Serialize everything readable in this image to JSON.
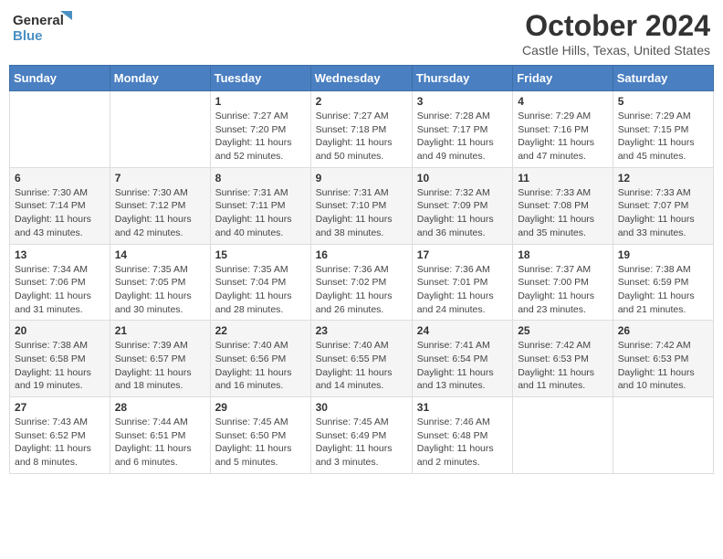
{
  "header": {
    "logo_line1": "General",
    "logo_line2": "Blue",
    "month_title": "October 2024",
    "location": "Castle Hills, Texas, United States"
  },
  "days_of_week": [
    "Sunday",
    "Monday",
    "Tuesday",
    "Wednesday",
    "Thursday",
    "Friday",
    "Saturday"
  ],
  "weeks": [
    [
      {
        "day": "",
        "info": ""
      },
      {
        "day": "",
        "info": ""
      },
      {
        "day": "1",
        "info": "Sunrise: 7:27 AM\nSunset: 7:20 PM\nDaylight: 11 hours and 52 minutes."
      },
      {
        "day": "2",
        "info": "Sunrise: 7:27 AM\nSunset: 7:18 PM\nDaylight: 11 hours and 50 minutes."
      },
      {
        "day": "3",
        "info": "Sunrise: 7:28 AM\nSunset: 7:17 PM\nDaylight: 11 hours and 49 minutes."
      },
      {
        "day": "4",
        "info": "Sunrise: 7:29 AM\nSunset: 7:16 PM\nDaylight: 11 hours and 47 minutes."
      },
      {
        "day": "5",
        "info": "Sunrise: 7:29 AM\nSunset: 7:15 PM\nDaylight: 11 hours and 45 minutes."
      }
    ],
    [
      {
        "day": "6",
        "info": "Sunrise: 7:30 AM\nSunset: 7:14 PM\nDaylight: 11 hours and 43 minutes."
      },
      {
        "day": "7",
        "info": "Sunrise: 7:30 AM\nSunset: 7:12 PM\nDaylight: 11 hours and 42 minutes."
      },
      {
        "day": "8",
        "info": "Sunrise: 7:31 AM\nSunset: 7:11 PM\nDaylight: 11 hours and 40 minutes."
      },
      {
        "day": "9",
        "info": "Sunrise: 7:31 AM\nSunset: 7:10 PM\nDaylight: 11 hours and 38 minutes."
      },
      {
        "day": "10",
        "info": "Sunrise: 7:32 AM\nSunset: 7:09 PM\nDaylight: 11 hours and 36 minutes."
      },
      {
        "day": "11",
        "info": "Sunrise: 7:33 AM\nSunset: 7:08 PM\nDaylight: 11 hours and 35 minutes."
      },
      {
        "day": "12",
        "info": "Sunrise: 7:33 AM\nSunset: 7:07 PM\nDaylight: 11 hours and 33 minutes."
      }
    ],
    [
      {
        "day": "13",
        "info": "Sunrise: 7:34 AM\nSunset: 7:06 PM\nDaylight: 11 hours and 31 minutes."
      },
      {
        "day": "14",
        "info": "Sunrise: 7:35 AM\nSunset: 7:05 PM\nDaylight: 11 hours and 30 minutes."
      },
      {
        "day": "15",
        "info": "Sunrise: 7:35 AM\nSunset: 7:04 PM\nDaylight: 11 hours and 28 minutes."
      },
      {
        "day": "16",
        "info": "Sunrise: 7:36 AM\nSunset: 7:02 PM\nDaylight: 11 hours and 26 minutes."
      },
      {
        "day": "17",
        "info": "Sunrise: 7:36 AM\nSunset: 7:01 PM\nDaylight: 11 hours and 24 minutes."
      },
      {
        "day": "18",
        "info": "Sunrise: 7:37 AM\nSunset: 7:00 PM\nDaylight: 11 hours and 23 minutes."
      },
      {
        "day": "19",
        "info": "Sunrise: 7:38 AM\nSunset: 6:59 PM\nDaylight: 11 hours and 21 minutes."
      }
    ],
    [
      {
        "day": "20",
        "info": "Sunrise: 7:38 AM\nSunset: 6:58 PM\nDaylight: 11 hours and 19 minutes."
      },
      {
        "day": "21",
        "info": "Sunrise: 7:39 AM\nSunset: 6:57 PM\nDaylight: 11 hours and 18 minutes."
      },
      {
        "day": "22",
        "info": "Sunrise: 7:40 AM\nSunset: 6:56 PM\nDaylight: 11 hours and 16 minutes."
      },
      {
        "day": "23",
        "info": "Sunrise: 7:40 AM\nSunset: 6:55 PM\nDaylight: 11 hours and 14 minutes."
      },
      {
        "day": "24",
        "info": "Sunrise: 7:41 AM\nSunset: 6:54 PM\nDaylight: 11 hours and 13 minutes."
      },
      {
        "day": "25",
        "info": "Sunrise: 7:42 AM\nSunset: 6:53 PM\nDaylight: 11 hours and 11 minutes."
      },
      {
        "day": "26",
        "info": "Sunrise: 7:42 AM\nSunset: 6:53 PM\nDaylight: 11 hours and 10 minutes."
      }
    ],
    [
      {
        "day": "27",
        "info": "Sunrise: 7:43 AM\nSunset: 6:52 PM\nDaylight: 11 hours and 8 minutes."
      },
      {
        "day": "28",
        "info": "Sunrise: 7:44 AM\nSunset: 6:51 PM\nDaylight: 11 hours and 6 minutes."
      },
      {
        "day": "29",
        "info": "Sunrise: 7:45 AM\nSunset: 6:50 PM\nDaylight: 11 hours and 5 minutes."
      },
      {
        "day": "30",
        "info": "Sunrise: 7:45 AM\nSunset: 6:49 PM\nDaylight: 11 hours and 3 minutes."
      },
      {
        "day": "31",
        "info": "Sunrise: 7:46 AM\nSunset: 6:48 PM\nDaylight: 11 hours and 2 minutes."
      },
      {
        "day": "",
        "info": ""
      },
      {
        "day": "",
        "info": ""
      }
    ]
  ]
}
